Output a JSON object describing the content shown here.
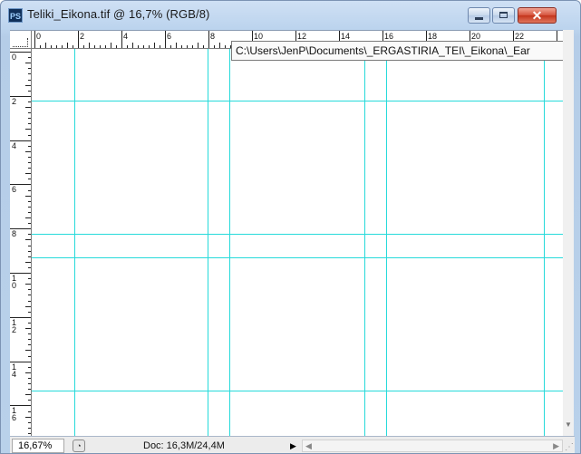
{
  "window": {
    "title": "Teliki_Eikona.tif @ 16,7% (RGB/8)",
    "app_icon": "PS",
    "buttons": {
      "minimize": "minimize-icon",
      "maximize": "maximize-icon",
      "close": "✕"
    }
  },
  "rulers": {
    "horizontal_labels": [
      "0",
      "2",
      "4",
      "6",
      "8",
      "10",
      "12",
      "14",
      "16",
      "18",
      "20",
      "22"
    ],
    "vertical_labels": [
      "0",
      "2",
      "4",
      "6",
      "8",
      "10",
      "12",
      "14",
      "16"
    ]
  },
  "tooltip": {
    "path": "C:\\Users\\JenP\\Documents\\_ERGASTIRIA_TEI\\_Eikona\\_Ear"
  },
  "status": {
    "zoom": "16,67%",
    "doc_info": "Doc: 16,3M/24,4M",
    "menu_arrow": "▶",
    "scroll_left": "◀",
    "scroll_right": "▶"
  },
  "colors": {
    "guide": "#26dada",
    "title_bar": "#bcd4ee",
    "close_button": "#c3341b"
  }
}
